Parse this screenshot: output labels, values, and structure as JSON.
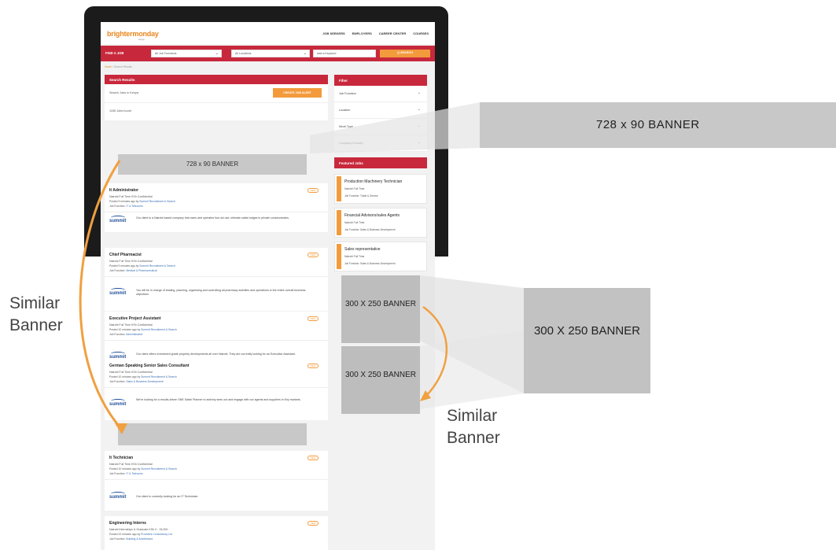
{
  "header": {
    "logo": "brightermonday",
    "logo_tagline": "Kenya",
    "nav": [
      "JOB SEEKERS",
      "EMPLOYERS",
      "CAREER CENTER",
      "COURSES"
    ]
  },
  "search_bar": {
    "find_label": "FIND A JOB",
    "function_select": "All Job Functions",
    "location_select": "All Locations",
    "keyword_placeholder": "Add a Keyword",
    "search_button": "Q SEARCH"
  },
  "breadcrumb": {
    "home": "Home",
    "separator": "/",
    "current": "Search Results"
  },
  "results": {
    "heading": "Search Results",
    "query_text": "Search Jobs in Kenya",
    "create_alert": "CREATE JOB ALERT",
    "count_text": "1155 Jobs found"
  },
  "inline_banner": "728 x 90 BANNER",
  "jobs": [
    {
      "title": "It Administrator",
      "badge": "NEW",
      "meta": "Nairobi  Full Time  KSh Confidential",
      "posted_prefix": "Posted 9 minutes ago by",
      "company": "Summit Recruitment & Search",
      "func_prefix": "Job Function:",
      "function": "IT & Telecoms",
      "logo": "summit",
      "desc": "Our client is a Nairobi based company that owns and operates four ski use, intimate safari lodges in private conservancies."
    },
    {
      "title": "Chief Pharmacist",
      "badge": "NEW",
      "meta": "Nairobi  Full Time  KSh Confidential",
      "posted_prefix": "Posted 9 minutes ago by",
      "company": "Summit Recruitment & Search",
      "func_prefix": "Job Function:",
      "function": "Medical & Pharmaceutical",
      "logo": "summit",
      "desc": "You will be in charge of leading, planning, organising and controlling all pharmacy activities and operations in the entire overall business objectives"
    },
    {
      "title": "Executive Project Assistant",
      "badge": "NEW",
      "meta": "Nairobi  Full Time  KSh Confidential",
      "posted_prefix": "Posted 10 minutes ago by",
      "company": "Summit Recruitment & Search",
      "func_prefix": "Job Function:",
      "function": "Administrative",
      "logo": "summit",
      "desc": "Our client offers investment grade property developments all over Nairobi. They are currently looking for an Executive Assistant."
    },
    {
      "title": "German Speaking Senior Sales Consultant",
      "badge": "NEW",
      "meta": "Nairobi  Full Time  KSh Confidential",
      "posted_prefix": "Posted 10 minutes ago by",
      "company": "Summit Recruitment & Search",
      "func_prefix": "Job Function:",
      "function": "Sales & Business Development",
      "logo": "summit",
      "desc": "We're looking for a results-driven SNE Safari Planner to actively seek out and engage with our agents and suppliers in Key markets."
    },
    {
      "title": "It Technician",
      "badge": "NEW",
      "meta": "Nairobi  Full Time  KSh Confidential",
      "posted_prefix": "Posted 10 minutes ago by",
      "company": "Summit Recruitment & Search",
      "func_prefix": "Job Function:",
      "function": "IT & Telecoms",
      "logo": "summit",
      "desc": "Our client is currently looking for an IT Technician."
    },
    {
      "title": "Engineering Interns",
      "badge": "NEW",
      "meta": "Nairobi  Internships & Graduate  KSh 0 - 15,000",
      "posted_prefix": "Posted 22 minutes ago by",
      "company": "Provident Consultancy Ltd",
      "func_prefix": "Job Function:",
      "function": "Building & Architecture",
      "logo": "",
      "desc": ""
    }
  ],
  "filter": {
    "heading": "Filter",
    "items": [
      "Job Function",
      "Location",
      "Work Type",
      "Company Industry"
    ]
  },
  "featured": {
    "heading": "Featured Jobs",
    "items": [
      {
        "title": "Production Machinery Technician",
        "meta": "Nairobi  Full Time",
        "func": "Job Function: Trade & Service"
      },
      {
        "title": "Financial Advisors/sales Agents",
        "meta": "Nairobi  Full Time",
        "func": "Job Function: Sales & Business Development"
      },
      {
        "title": "Sales representative",
        "meta": "Nairobi  Full Time",
        "func": "Job Function: Sales & Business Development"
      }
    ]
  },
  "side_banners": [
    "300 X 250 BANNER",
    "300 X 250 BANNER"
  ],
  "annotations": {
    "leaderboard": "728 x 90 BANNER",
    "medium_rect": "300 X 250 BANNER",
    "similar_left": "Similar Banner",
    "similar_right": "Similar Banner"
  },
  "colors": {
    "brand_red": "#c8283c",
    "brand_orange": "#f39b3c",
    "arrow_orange": "#f0a040"
  }
}
